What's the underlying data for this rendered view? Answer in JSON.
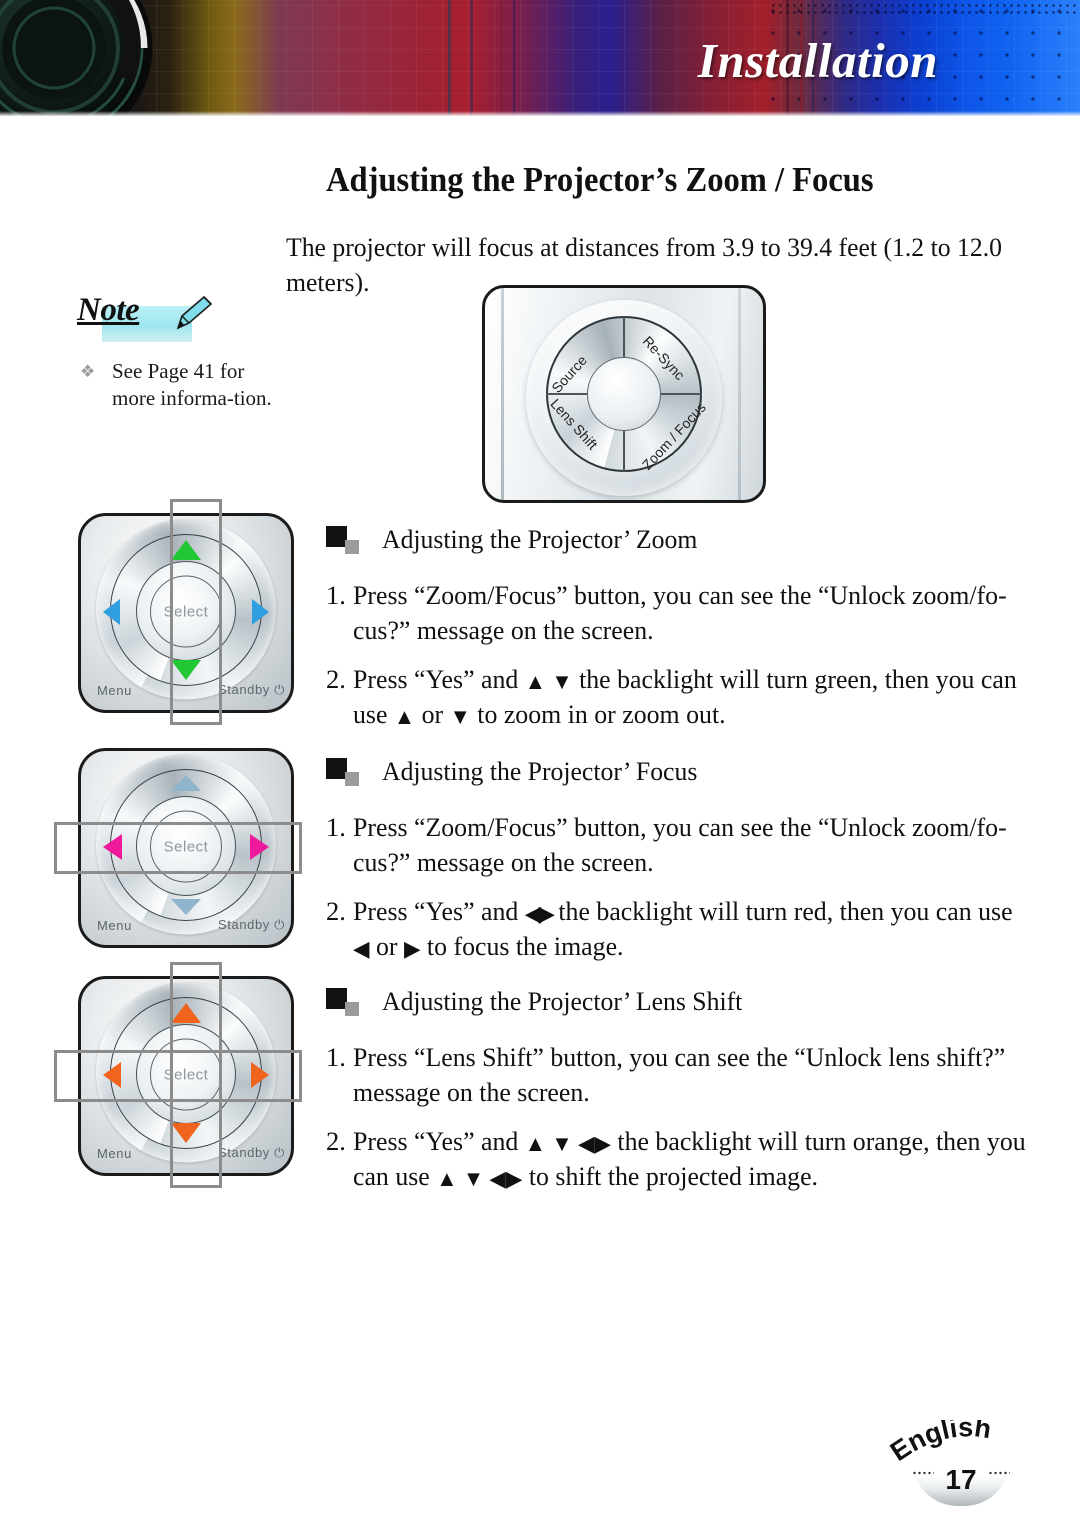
{
  "banner": {
    "title": "Installation",
    "lens_icon": "camera-lens-icon"
  },
  "heading": "Adjusting the Projector’s Zoom / Focus",
  "intro": "The projector will focus at distances from 3.9 to 39.4 feet (1.2 to 12.0 meters).",
  "note": {
    "label": "Note",
    "pencil_icon": "pencil-icon",
    "bullet": "❖",
    "items": [
      "See Page 41 for more informa-tion."
    ]
  },
  "control_panel": {
    "labels": {
      "source": "Source",
      "resync": "Re-Sync",
      "lens_shift": "Lens Shift",
      "zoom_focus": "Zoom / Focus"
    }
  },
  "keypads": [
    {
      "name": "zoom-keypad",
      "select_label": "Select",
      "menu_label": "Menu",
      "standby_label": "Standby ⏻",
      "arrow_color": "#22c833",
      "side_arrow_color": "#2f9fe0",
      "highlight": "vertical"
    },
    {
      "name": "focus-keypad",
      "select_label": "Select",
      "menu_label": "Menu",
      "standby_label": "Standby ⏻",
      "arrow_color": "#8fb4cc",
      "side_arrow_color": "#ee1a9b",
      "highlight": "horizontal"
    },
    {
      "name": "lens-shift-keypad",
      "select_label": "Select",
      "menu_label": "Menu",
      "standby_label": "Standby ⏻",
      "arrow_color": "#f0641e",
      "side_arrow_color": "#f0641e",
      "highlight": "cross"
    }
  ],
  "sections": [
    {
      "title": "Adjusting the Projector’ Zoom",
      "steps": [
        {
          "num": "1.",
          "text": "Press “Zoom/Focus” button, you can see the “Unlock zoom/fo-cus?” message on the screen."
        },
        {
          "num": "2.",
          "text_a": "Press “Yes” and ",
          "arrows_a": "▲ ▼",
          "text_b": " the backlight will turn green, then you can use ",
          "arrows_b": "▲",
          "text_c": " or ",
          "arrows_c": "▼",
          "text_d": " to zoom in or zoom out."
        }
      ]
    },
    {
      "title": "Adjusting the Projector’ Focus",
      "steps": [
        {
          "num": "1.",
          "text": "Press “Zoom/Focus” button, you can see the “Unlock zoom/fo-cus?” message on the screen."
        },
        {
          "num": "2.",
          "text_a": "Press “Yes” and ",
          "arrows_a": "◀▶",
          "text_b": " the backlight will turn red, then you can use ",
          "arrows_b": "◀",
          "text_c": " or ",
          "arrows_c": "▶",
          "text_d": " to focus the image."
        }
      ]
    },
    {
      "title": "Adjusting the Projector’ Lens Shift",
      "steps": [
        {
          "num": "1.",
          "text": "Press “Lens Shift” button, you can see the “Unlock lens shift?” message on the screen."
        },
        {
          "num": "2.",
          "text_a": "Press “Yes” and ",
          "arrows_a": "▲ ▼ ◀▶",
          "text_b": " the backlight will turn orange, then you can use ",
          "arrows_b": "▲ ▼ ◀▶",
          "text_c": "",
          "arrows_c": "",
          "text_d": " to shift the projected image."
        }
      ]
    }
  ],
  "footer": {
    "language": "English",
    "page_number": "17"
  }
}
